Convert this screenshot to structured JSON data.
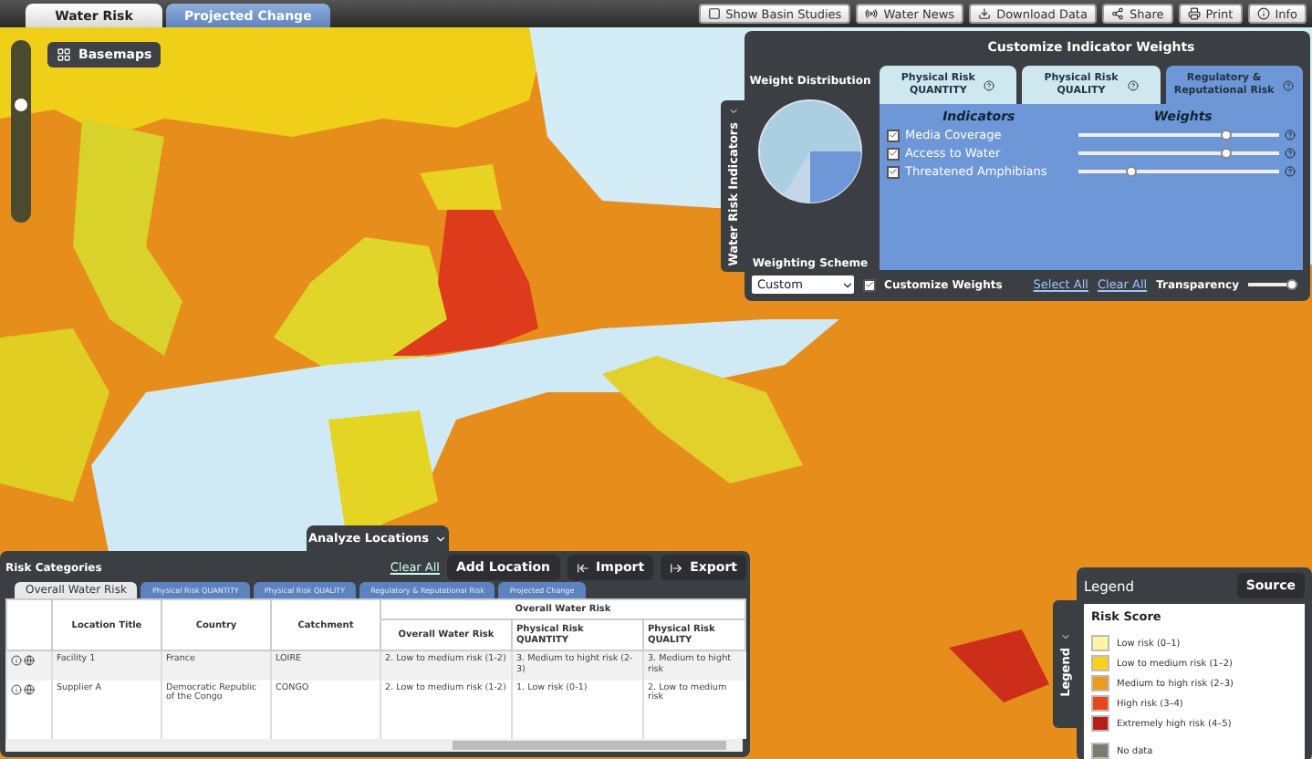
{
  "top_tabs": [
    {
      "label": "Water Risk",
      "selected": true
    },
    {
      "label": "Projected Change",
      "selected": false
    }
  ],
  "toolbar_buttons": [
    "Show Basin Studies",
    "Water News",
    "Download Data",
    "Share",
    "Print",
    "Info"
  ],
  "map": {
    "basemaps": "Basemaps",
    "zoom": {
      "level": 0.7
    }
  },
  "weights_panel": {
    "side_tab": "Water Risk Indicators",
    "title": "Customize Indicator Weights",
    "distribution_label": "Weight Distribution",
    "tabs": [
      {
        "label": "Physical Risk\nQUANTITY",
        "selected": false
      },
      {
        "label": "Physical Risk\nQUALITY",
        "selected": false
      },
      {
        "label": "Regulatory &\nReputational Risk",
        "selected": true
      }
    ],
    "indicators_header": "Indicators",
    "weights_header": "Weights",
    "indicators": [
      {
        "label": "Media Coverage",
        "checked": true,
        "level": 0.74
      },
      {
        "label": "Access to Water",
        "checked": true,
        "level": 0.74
      },
      {
        "label": "Threatened Amphibians",
        "checked": true,
        "level": 0.26
      }
    ],
    "scheme_label": "Weighting Scheme",
    "scheme_value": "Custom",
    "customize": {
      "label": "Customize Weights",
      "checked": true
    },
    "select_all": "Select All",
    "clear_all": "Clear All",
    "transparency": {
      "label": "Transparency",
      "level": 1
    }
  },
  "analyze_panel": {
    "tab": "Analyze Locations",
    "title": "Risk Categories",
    "clear_all": "Clear All",
    "add_location": "Add Location",
    "import": "Import",
    "export": "Export",
    "category_tabs": [
      {
        "label": "Overall Water Risk",
        "selected": true
      },
      {
        "label": "Physical Risk QUANTITY",
        "selected": false
      },
      {
        "label": "Physical Risk QUALITY",
        "selected": false
      },
      {
        "label": "Regulatory & Reputational Risk",
        "selected": false
      },
      {
        "label": "Projected Change",
        "selected": false
      }
    ],
    "table": {
      "columns": [
        "Location Title",
        "Country",
        "Catchment"
      ],
      "group_header": "Overall Water Risk",
      "group_columns": [
        "Overall Water Risk",
        "Physical Risk QUANTITY",
        "Physical Risk QUALITY"
      ],
      "rows": [
        [
          "Facility 1",
          "France",
          "LOIRE",
          "2. Low to medium risk (1-2)",
          "3. Medium to hight risk (2-3)",
          "3. Medium to hight risk"
        ],
        [
          "Supplier A",
          "Democratic Republic of the Congo",
          "CONGO",
          "2. Low to medium risk (1-2)",
          "1. Low risk (0-1)",
          "2. Low to medium risk"
        ]
      ]
    }
  },
  "legend": {
    "side_tab": "Legend",
    "title": "Legend",
    "source": "Source",
    "subtitle": "Risk Score",
    "items": [
      {
        "label": "Low risk (0–1)",
        "color": "#fff3a6"
      },
      {
        "label": "Low to medium risk (1–2)",
        "color": "#f6d21c"
      },
      {
        "label": "Medium to high risk (2–3)",
        "color": "#ee9a1e"
      },
      {
        "label": "High risk (3–4)",
        "color": "#e5481c"
      },
      {
        "label": "Extremely high risk (4–5)",
        "color": "#b2201a"
      },
      {
        "label": "No data",
        "color": "#7d7c6c"
      }
    ]
  }
}
